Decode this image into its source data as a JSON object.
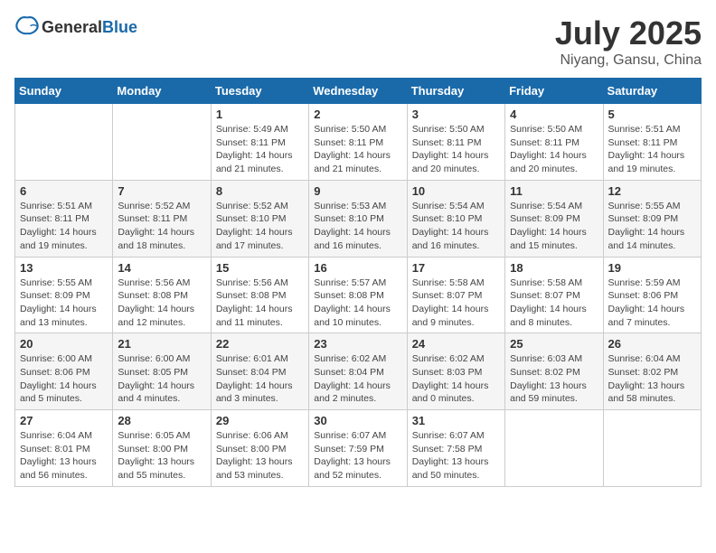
{
  "header": {
    "logo_general": "General",
    "logo_blue": "Blue",
    "month_year": "July 2025",
    "location": "Niyang, Gansu, China"
  },
  "weekdays": [
    "Sunday",
    "Monday",
    "Tuesday",
    "Wednesday",
    "Thursday",
    "Friday",
    "Saturday"
  ],
  "weeks": [
    [
      {
        "day": "",
        "info": ""
      },
      {
        "day": "",
        "info": ""
      },
      {
        "day": "1",
        "info": "Sunrise: 5:49 AM\nSunset: 8:11 PM\nDaylight: 14 hours and 21 minutes."
      },
      {
        "day": "2",
        "info": "Sunrise: 5:50 AM\nSunset: 8:11 PM\nDaylight: 14 hours and 21 minutes."
      },
      {
        "day": "3",
        "info": "Sunrise: 5:50 AM\nSunset: 8:11 PM\nDaylight: 14 hours and 20 minutes."
      },
      {
        "day": "4",
        "info": "Sunrise: 5:50 AM\nSunset: 8:11 PM\nDaylight: 14 hours and 20 minutes."
      },
      {
        "day": "5",
        "info": "Sunrise: 5:51 AM\nSunset: 8:11 PM\nDaylight: 14 hours and 19 minutes."
      }
    ],
    [
      {
        "day": "6",
        "info": "Sunrise: 5:51 AM\nSunset: 8:11 PM\nDaylight: 14 hours and 19 minutes."
      },
      {
        "day": "7",
        "info": "Sunrise: 5:52 AM\nSunset: 8:11 PM\nDaylight: 14 hours and 18 minutes."
      },
      {
        "day": "8",
        "info": "Sunrise: 5:52 AM\nSunset: 8:10 PM\nDaylight: 14 hours and 17 minutes."
      },
      {
        "day": "9",
        "info": "Sunrise: 5:53 AM\nSunset: 8:10 PM\nDaylight: 14 hours and 16 minutes."
      },
      {
        "day": "10",
        "info": "Sunrise: 5:54 AM\nSunset: 8:10 PM\nDaylight: 14 hours and 16 minutes."
      },
      {
        "day": "11",
        "info": "Sunrise: 5:54 AM\nSunset: 8:09 PM\nDaylight: 14 hours and 15 minutes."
      },
      {
        "day": "12",
        "info": "Sunrise: 5:55 AM\nSunset: 8:09 PM\nDaylight: 14 hours and 14 minutes."
      }
    ],
    [
      {
        "day": "13",
        "info": "Sunrise: 5:55 AM\nSunset: 8:09 PM\nDaylight: 14 hours and 13 minutes."
      },
      {
        "day": "14",
        "info": "Sunrise: 5:56 AM\nSunset: 8:08 PM\nDaylight: 14 hours and 12 minutes."
      },
      {
        "day": "15",
        "info": "Sunrise: 5:56 AM\nSunset: 8:08 PM\nDaylight: 14 hours and 11 minutes."
      },
      {
        "day": "16",
        "info": "Sunrise: 5:57 AM\nSunset: 8:08 PM\nDaylight: 14 hours and 10 minutes."
      },
      {
        "day": "17",
        "info": "Sunrise: 5:58 AM\nSunset: 8:07 PM\nDaylight: 14 hours and 9 minutes."
      },
      {
        "day": "18",
        "info": "Sunrise: 5:58 AM\nSunset: 8:07 PM\nDaylight: 14 hours and 8 minutes."
      },
      {
        "day": "19",
        "info": "Sunrise: 5:59 AM\nSunset: 8:06 PM\nDaylight: 14 hours and 7 minutes."
      }
    ],
    [
      {
        "day": "20",
        "info": "Sunrise: 6:00 AM\nSunset: 8:06 PM\nDaylight: 14 hours and 5 minutes."
      },
      {
        "day": "21",
        "info": "Sunrise: 6:00 AM\nSunset: 8:05 PM\nDaylight: 14 hours and 4 minutes."
      },
      {
        "day": "22",
        "info": "Sunrise: 6:01 AM\nSunset: 8:04 PM\nDaylight: 14 hours and 3 minutes."
      },
      {
        "day": "23",
        "info": "Sunrise: 6:02 AM\nSunset: 8:04 PM\nDaylight: 14 hours and 2 minutes."
      },
      {
        "day": "24",
        "info": "Sunrise: 6:02 AM\nSunset: 8:03 PM\nDaylight: 14 hours and 0 minutes."
      },
      {
        "day": "25",
        "info": "Sunrise: 6:03 AM\nSunset: 8:02 PM\nDaylight: 13 hours and 59 minutes."
      },
      {
        "day": "26",
        "info": "Sunrise: 6:04 AM\nSunset: 8:02 PM\nDaylight: 13 hours and 58 minutes."
      }
    ],
    [
      {
        "day": "27",
        "info": "Sunrise: 6:04 AM\nSunset: 8:01 PM\nDaylight: 13 hours and 56 minutes."
      },
      {
        "day": "28",
        "info": "Sunrise: 6:05 AM\nSunset: 8:00 PM\nDaylight: 13 hours and 55 minutes."
      },
      {
        "day": "29",
        "info": "Sunrise: 6:06 AM\nSunset: 8:00 PM\nDaylight: 13 hours and 53 minutes."
      },
      {
        "day": "30",
        "info": "Sunrise: 6:07 AM\nSunset: 7:59 PM\nDaylight: 13 hours and 52 minutes."
      },
      {
        "day": "31",
        "info": "Sunrise: 6:07 AM\nSunset: 7:58 PM\nDaylight: 13 hours and 50 minutes."
      },
      {
        "day": "",
        "info": ""
      },
      {
        "day": "",
        "info": ""
      }
    ]
  ]
}
